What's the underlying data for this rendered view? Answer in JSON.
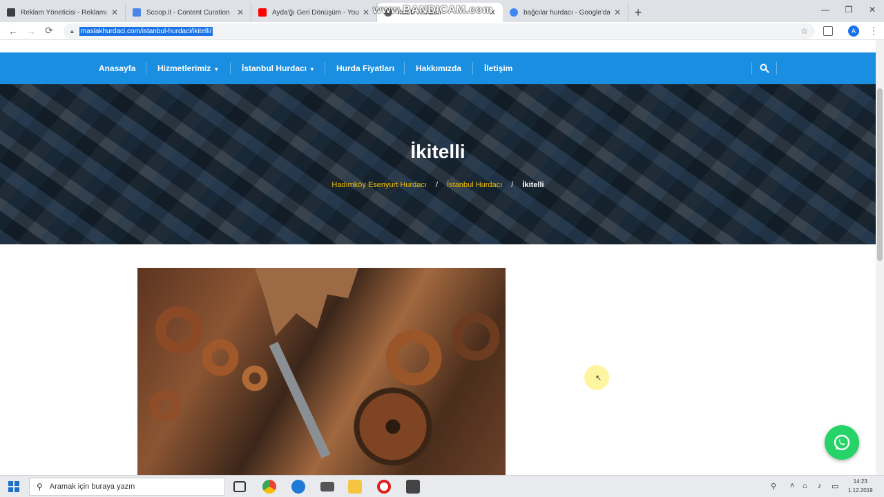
{
  "browser": {
    "tabs": [
      {
        "title": "Reklam Yöneticisi - Reklamın",
        "favicon_color": "#3c4043",
        "active": false
      },
      {
        "title": "Scoop.it - Content Curation",
        "favicon_color": "#4a86e8",
        "active": false
      },
      {
        "title": "Ayda'ğı Geri Dönüşüm - You",
        "favicon_color": "#ff0000",
        "active": false
      },
      {
        "title": "İkitelli Hurdacı",
        "favicon_color": "#5f6368",
        "active": true
      },
      {
        "title": "bağcılar hurdacı - Google'da",
        "favicon_color": "#4285f4",
        "active": false
      }
    ],
    "watermark": "www.BANDICAM.com",
    "address": "maslakhurdaci.com/istanbul-hurdaci/ikitelli/",
    "avatar_letter": "A"
  },
  "site": {
    "nav": [
      {
        "label": "Anasayfa",
        "has_dropdown": false
      },
      {
        "label": "Hizmetlerimiz",
        "has_dropdown": true
      },
      {
        "label": "İstanbul Hurdacı",
        "has_dropdown": true
      },
      {
        "label": "Hurda Fiyatları",
        "has_dropdown": false
      },
      {
        "label": "Hakkımızda",
        "has_dropdown": false
      },
      {
        "label": "İletişim",
        "has_dropdown": false
      }
    ],
    "nav_color": "#1a8ee1",
    "hero_title": "İkitelli",
    "breadcrumb": {
      "links": [
        "Hadımköy Esenyurt Hurdacı",
        "İstanbul Hurdacı"
      ],
      "current": "İkitelli",
      "link_color": "#f2c200"
    }
  },
  "taskbar": {
    "search_placeholder": "Aramak için buraya yazın",
    "time": "14:23",
    "date": "1.12.2019"
  }
}
